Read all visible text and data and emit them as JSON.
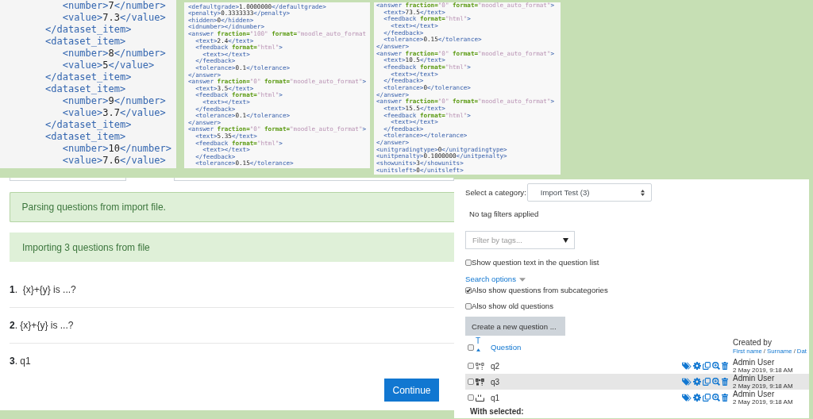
{
  "code_panels": [
    {
      "lines": [
        "   <number>7</number>",
        "   <value>7.3</value>",
        "</dataset_item>",
        "<dataset_item>",
        "   <number>8</number>",
        "   <value>5</value>",
        "</dataset_item>",
        "<dataset_item>",
        "   <number>9</number>",
        "   <value>3.7</value>",
        "</dataset_item>",
        "<dataset_item>",
        "   <number>10</number>",
        "   <value>7.6</value>"
      ]
    },
    {
      "lines": [
        "<defaultgrade>1.0000000</defaultgrade>",
        "<penalty>0.3333333</penalty>",
        "<hidden>0</hidden>",
        "<idnumber></idnumber>",
        "<answer fraction=\"100\" format=\"moodle_auto_format",
        "  <text>2.4</text>",
        "  <feedback format=\"html\">",
        "    <text></text>",
        "  </feedback>",
        "  <tolerance>0.1</tolerance>",
        "</answer>",
        "<answer fraction=\"0\" format=\"moodle_auto_format\">",
        "  <text>3.5</text>",
        "  <feedback format=\"html\">",
        "    <text></text>",
        "  </feedback>",
        "  <tolerance>0.1</tolerance>",
        "</answer>",
        "<answer fraction=\"0\" format=\"moodle_auto_format\">",
        "  <text>5.35</text>",
        "  <feedback format=\"html\">",
        "    <text></text>",
        "  </feedback>",
        "  <tolerance>0.15</tolerance>"
      ]
    },
    {
      "lines": [
        "<answer fraction=\"0\" format=\"moodle_auto_format\">",
        "  <text>73.5</text>",
        "  <feedback format=\"html\">",
        "    <text></text>",
        "  </feedback>",
        "  <tolerance>0.15</tolerance>",
        "</answer>",
        "<answer fraction=\"0\" format=\"moodle_auto_format\">",
        "  <text>10.5</text>",
        "  <feedback format=\"html\">",
        "    <text></text>",
        "  </feedback>",
        "  <tolerance>0</tolerance>",
        "</answer>",
        "<answer fraction=\"0\" format=\"moodle_auto_format\">",
        "  <text>15.5</text>",
        "  <feedback format=\"html\">",
        "    <text></text>",
        "  </feedback>",
        "  <tolerance></tolerance>",
        "</answer>",
        "<unitgradingtype>0</unitgradingtype>",
        "<unitpenalty>0.1000000</unitpenalty>",
        "<showunits>3</showunits>",
        "<unitsleft>0</unitsleft>"
      ]
    }
  ],
  "import_page": {
    "top_fields": [
      {
        "kind": "input"
      },
      {
        "kind": "input"
      }
    ],
    "messages": [
      {
        "kind": "bordered",
        "text": "Parsing questions from import file."
      },
      {
        "kind": "plain",
        "text": "Importing 3 questions from file"
      }
    ],
    "questions": [
      "**1**.  {x}+{y} is ...?",
      "**2**. {x}+{y} is ...?",
      "**3**. q1"
    ],
    "continue_button": "Continue"
  },
  "question_bank": {
    "category_label": "Select a category:",
    "category_select": "Import Test (3)",
    "tag_filter_status": "No tag filters applied",
    "tag_filter": {
      "placeholder": "Filter by tags..."
    },
    "show_text_option": {
      "label": "Show question text in the question list",
      "checked": false
    },
    "search_options_link": "Search options",
    "search_options": [
      {
        "label": "Also show questions from subcategories",
        "checked": true
      },
      {
        "label": "Also show old questions",
        "checked": false
      }
    ],
    "create_button": "Create a new question ...",
    "table": {
      "select_all": {
        "checked": false
      },
      "type_sort_link": "T",
      "question_sort_link": "Question",
      "created_by_heading": "Created by",
      "created_by_sort": [
        {
          "kind": "link",
          "text": "First name"
        },
        {
          "kind": "separator",
          "text": "/"
        },
        {
          "kind": "link",
          "text": "Surname"
        },
        {
          "kind": "separator",
          "text": "/"
        },
        {
          "kind": "link",
          "text": "Dat"
        }
      ],
      "rows": [
        {
          "kind": "sum",
          "name": "q2",
          "checked": false,
          "highlighted": false,
          "created_by": "Admin User",
          "created_on": "2 May 2019, 9:18 AM"
        },
        {
          "kind": "boldsum",
          "name": "q3",
          "checked": false,
          "highlighted": true,
          "created_by": "Admin User",
          "created_on": "2 May 2019, 9:18 AM"
        },
        {
          "kind": "blank",
          "name": "q1",
          "checked": false,
          "highlighted": false,
          "created_by": "Admin User",
          "created_on": "2 May 2019, 9:18 AM"
        }
      ]
    },
    "with_selected": "With selected:"
  }
}
